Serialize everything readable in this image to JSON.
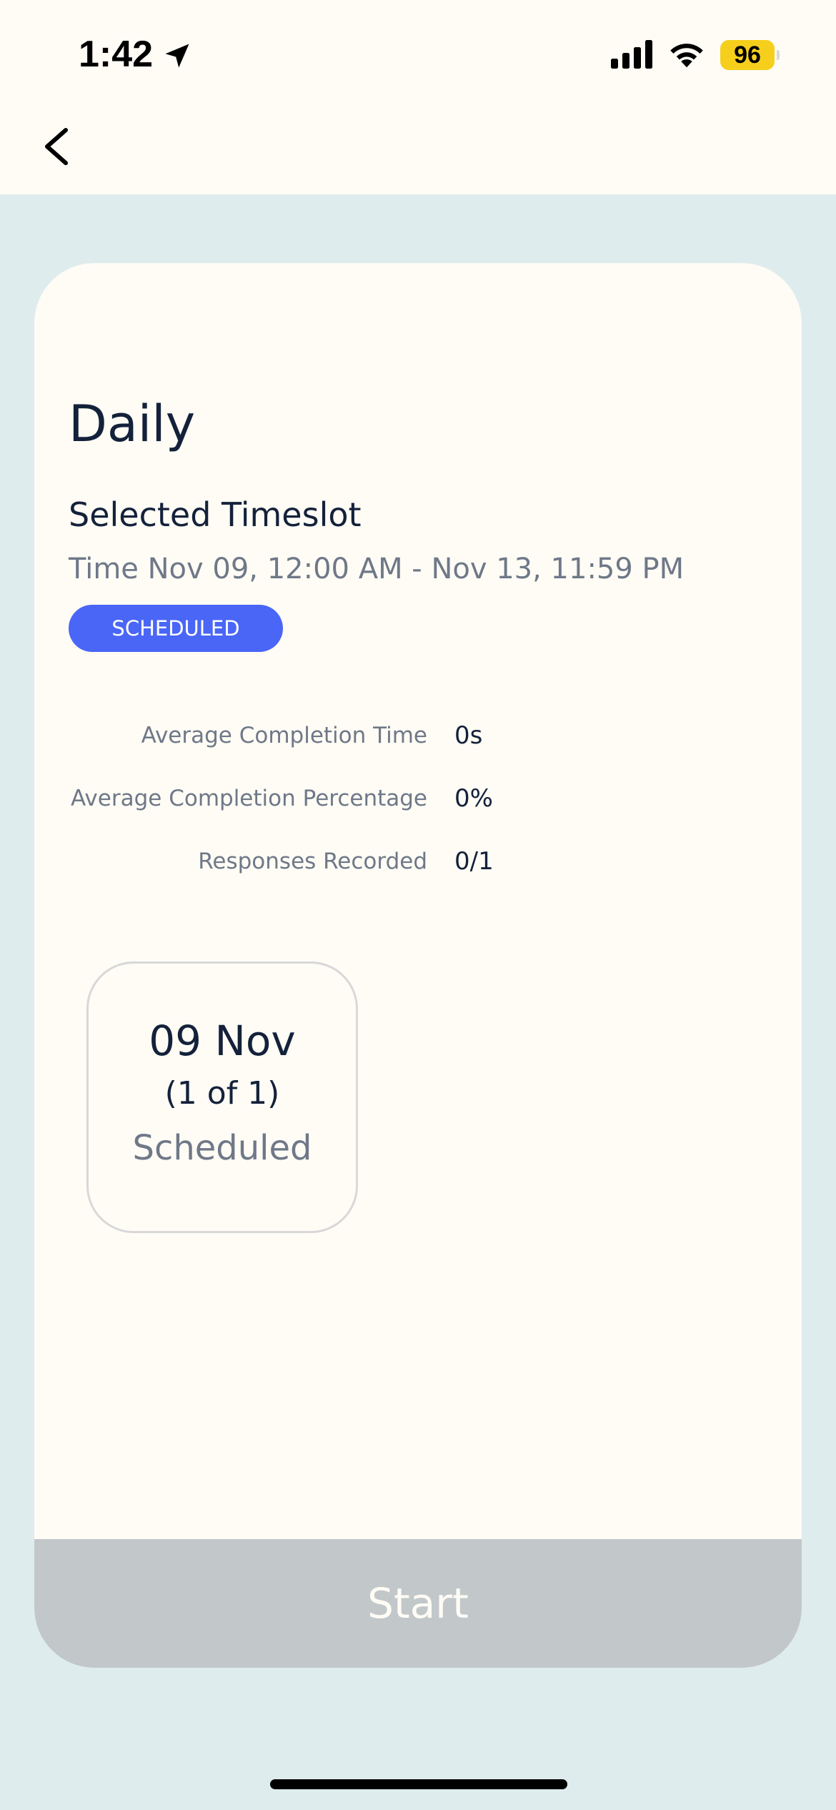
{
  "status_bar": {
    "time": "1:42",
    "battery": "96"
  },
  "header": {
    "back_icon": "chevron-left-icon"
  },
  "card": {
    "title": "Daily",
    "section_title": "Selected Timeslot",
    "time_range": "Time Nov 09, 12:00 AM - Nov 13, 11:59 PM",
    "status_badge": "SCHEDULED",
    "stats": [
      {
        "label": "Average Completion Time",
        "value": "0s"
      },
      {
        "label": "Average Completion Percentage",
        "value": "0%"
      },
      {
        "label": "Responses Recorded",
        "value": "0/1"
      }
    ],
    "slot": {
      "date": "09 Nov",
      "count": "(1 of 1)",
      "status": "Scheduled"
    },
    "start_label": "Start"
  },
  "colors": {
    "page_background": "#dfecee",
    "card_background": "#fefcf5",
    "badge_blue": "#4a66f6",
    "button_disabled": "#c2c7ca",
    "battery_yellow": "#f6cf1c"
  }
}
